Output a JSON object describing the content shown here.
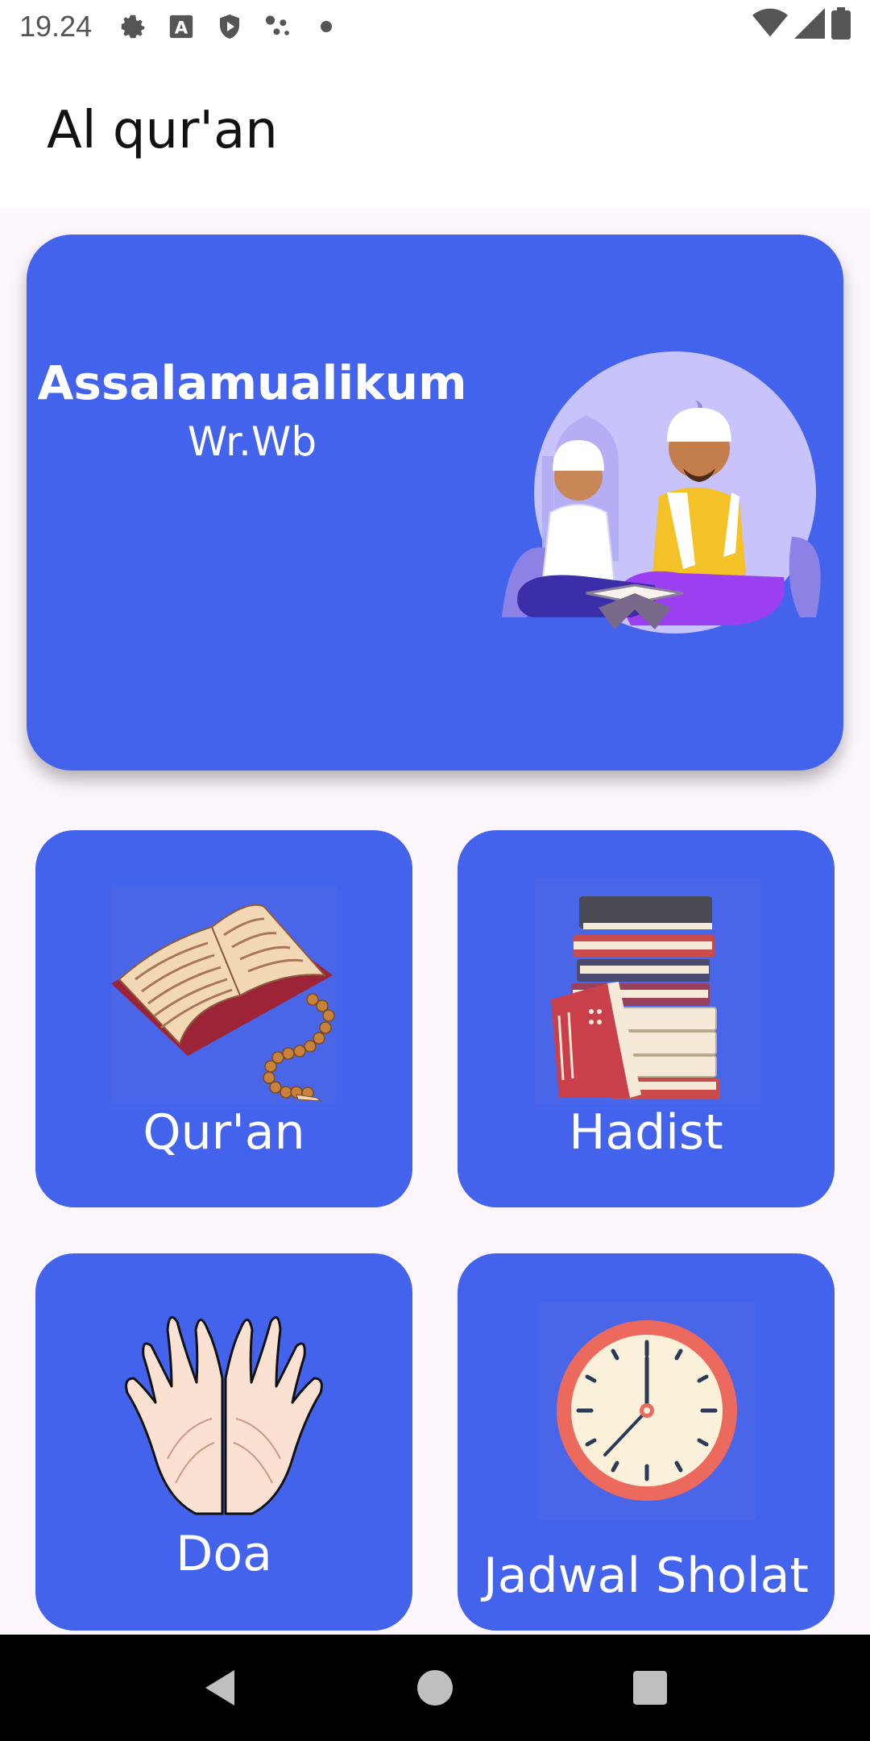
{
  "status_bar": {
    "time": "19.24",
    "left_icons": [
      "settings-icon",
      "a-box-icon",
      "shield-play-icon",
      "dots-cluster-icon",
      "dot-icon"
    ],
    "right_icons": [
      "wifi-icon",
      "signal-icon",
      "battery-icon"
    ]
  },
  "app_bar": {
    "title": "Al qur'an"
  },
  "hero": {
    "greeting": "Assalamualikum",
    "greeting_sub": "Wr.Wb"
  },
  "tiles": [
    {
      "label": "Qur'an",
      "icon": "open-quran-book-icon"
    },
    {
      "label": "Hadist",
      "icon": "book-stack-icon"
    },
    {
      "label": "Doa",
      "icon": "praying-hands-icon"
    },
    {
      "label": "Jadwal Sholat",
      "icon": "clock-icon"
    }
  ],
  "nav_bar": {
    "buttons": [
      "back-icon",
      "home-icon",
      "recents-icon"
    ]
  },
  "colors": {
    "accent": "#4463ec",
    "background": "#fdf6fd"
  }
}
